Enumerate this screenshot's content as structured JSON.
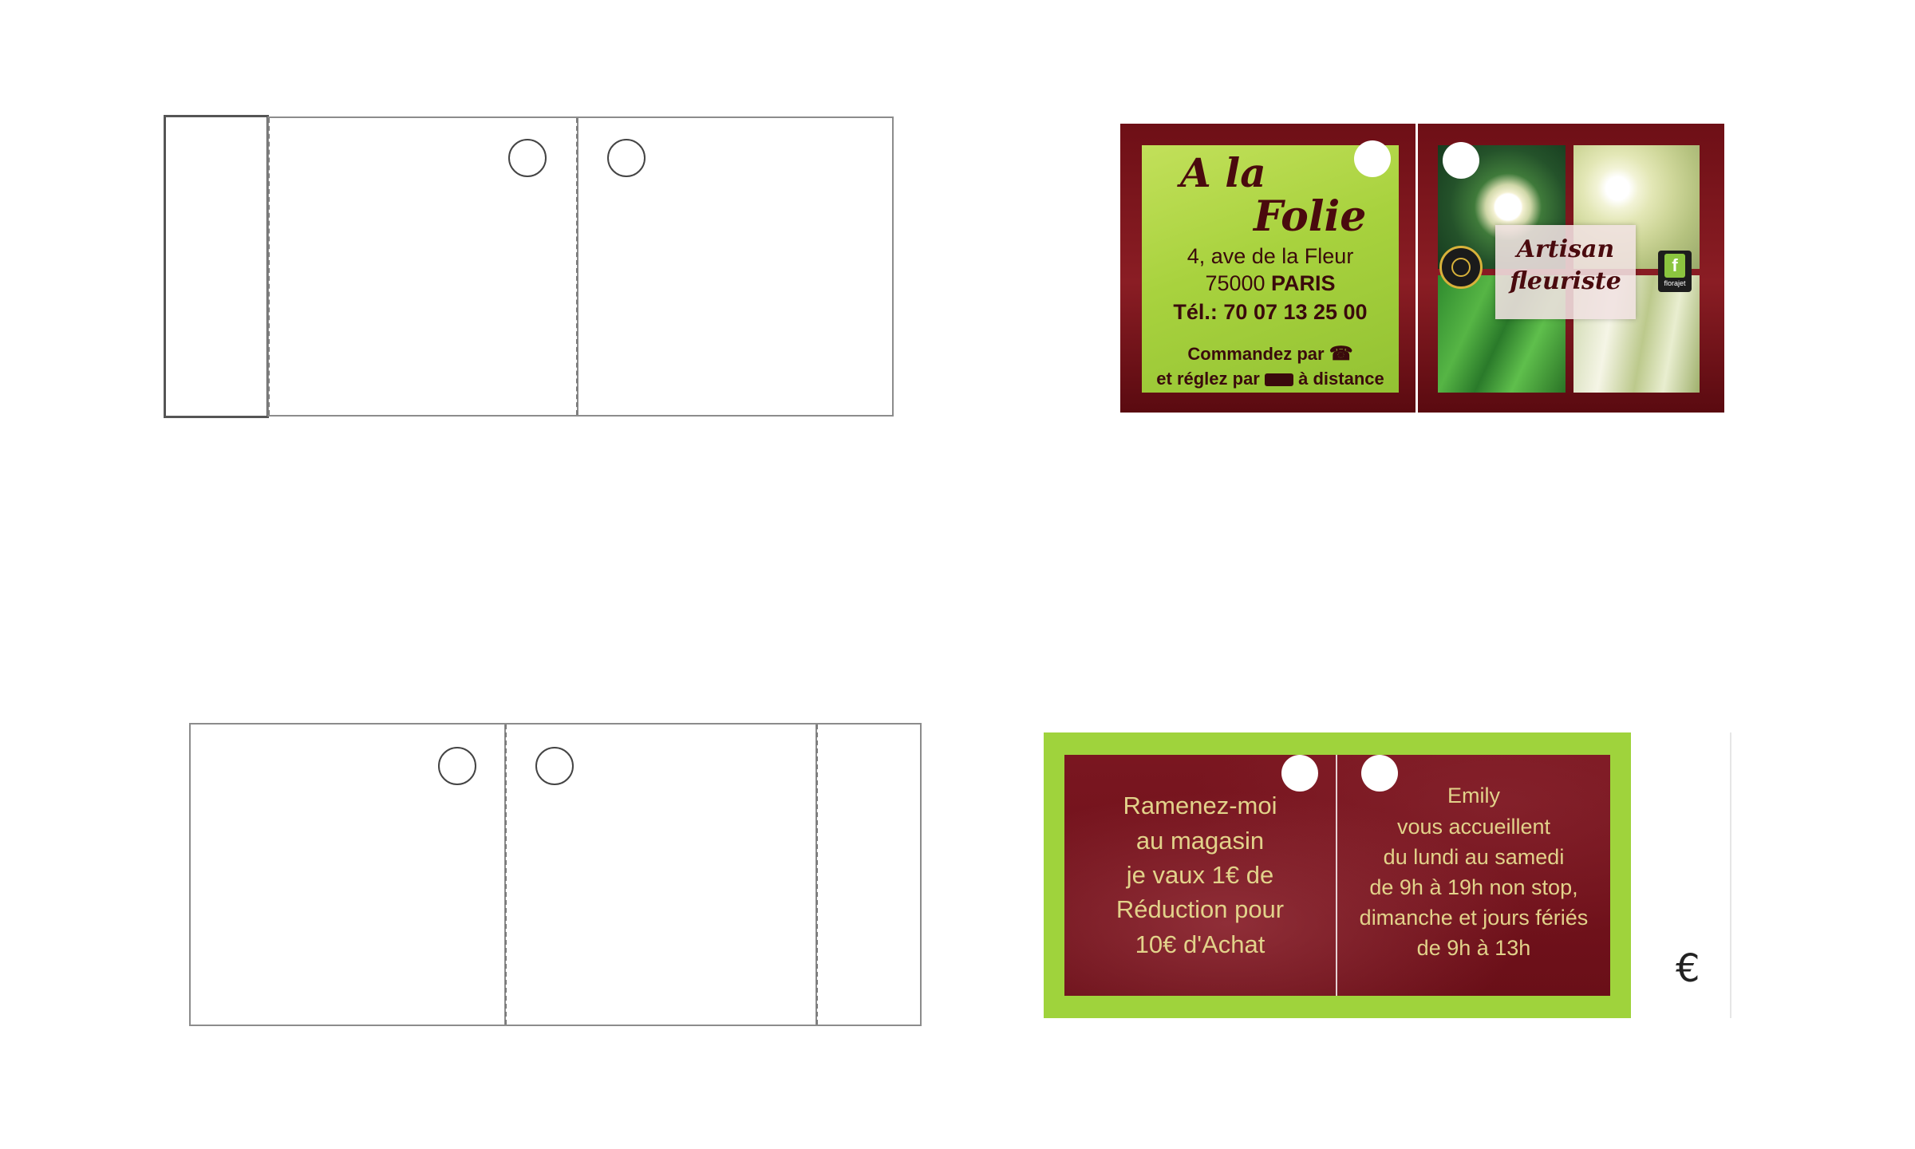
{
  "front_card": {
    "shop_name_line1": "A la",
    "shop_name_line2": "Folie",
    "address": "4, ave de la Fleur",
    "postcode": "75000",
    "city": "PARIS",
    "phone": "Tél.: 70 07 13 25 00",
    "order_line": "Commandez par",
    "pay_line_start": "et réglez par",
    "pay_line_end": "à distance",
    "badge_line1": "Artisan",
    "badge_line2": "fleuriste",
    "logo_text": "florajet",
    "order_icon": "telephone-icon",
    "pay_icon": "carte-bancaire-icon"
  },
  "back_card": {
    "coupon_lines": [
      "Ramenez-moi",
      "au magasin",
      "je vaux 1€ de",
      "Réduction pour",
      "10€ d'Achat"
    ],
    "hours_lines": [
      "Emily",
      "vous accueillent",
      "du lundi au samedi",
      "de 9h à 19h non stop,",
      "dimanche et jours fériés",
      "de 9h à 13h"
    ]
  },
  "euro_symbol": "€",
  "colors": {
    "maroon": "#7a1620",
    "lime": "#9fd33c",
    "gold_text": "#e2d28a"
  }
}
